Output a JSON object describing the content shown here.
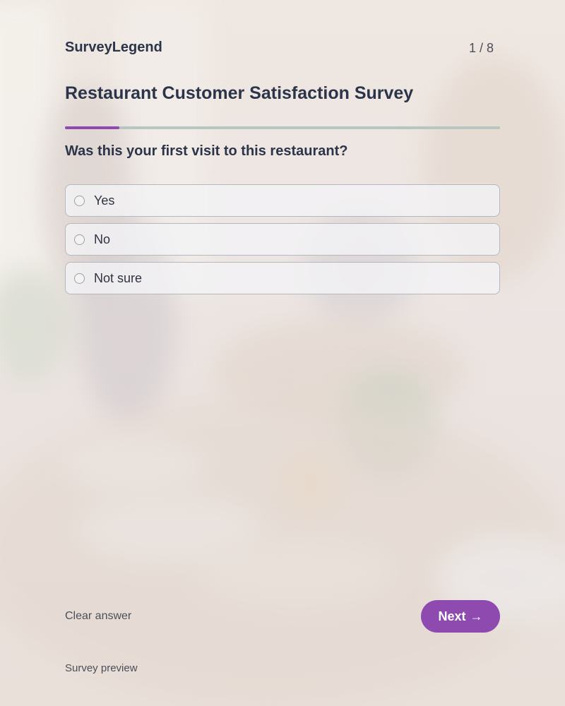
{
  "header": {
    "brand": "SurveyLegend",
    "counter": "1 / 8"
  },
  "survey": {
    "title": "Restaurant Customer Satisfaction Survey",
    "progress_fraction": 0.125,
    "accent_color": "#8f4ab0"
  },
  "question": {
    "text": "Was this your first visit to this restaurant?",
    "options": [
      {
        "label": "Yes"
      },
      {
        "label": "No"
      },
      {
        "label": "Not sure"
      }
    ]
  },
  "actions": {
    "clear_label": "Clear answer",
    "next_label": "Next",
    "next_icon": "arrow-right-icon"
  },
  "footer": {
    "label": "Survey preview"
  }
}
